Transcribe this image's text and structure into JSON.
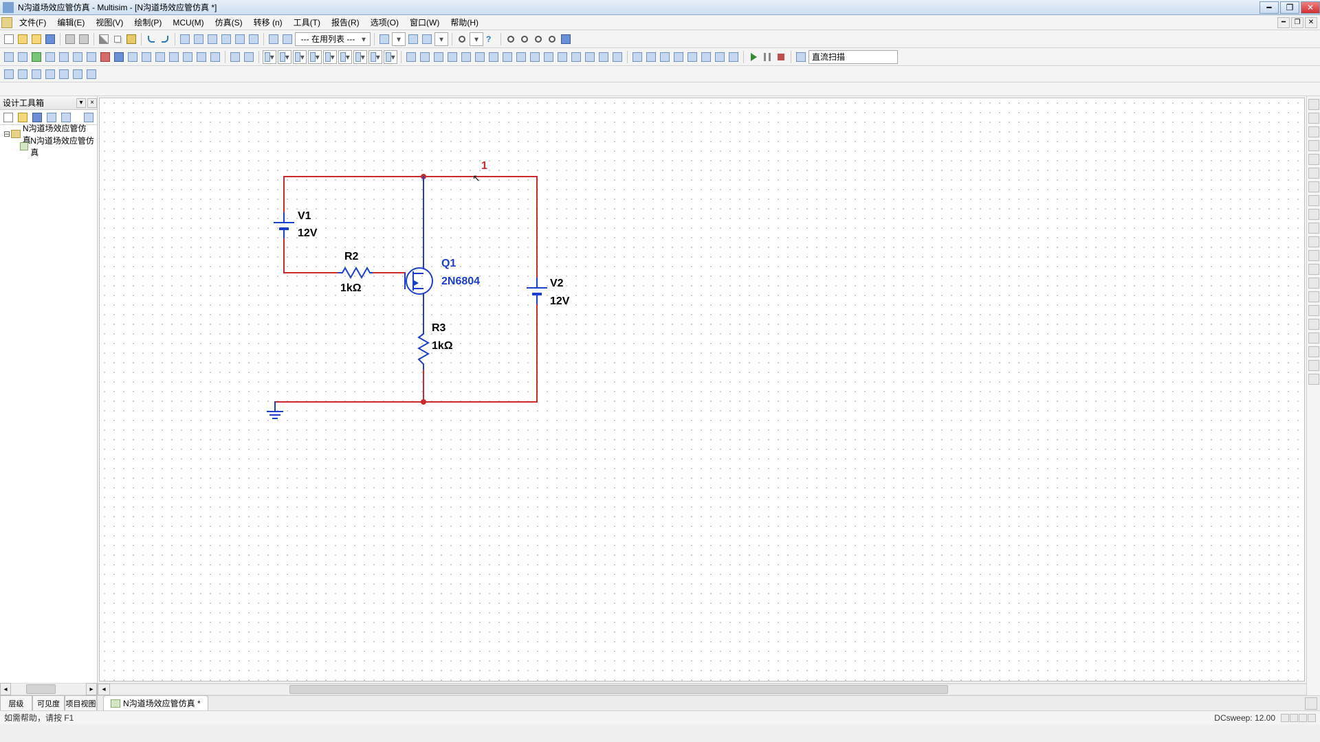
{
  "title": "N沟道场效应管仿真 - Multisim - [N沟道场效应管仿真 *]",
  "menus": [
    "文件(F)",
    "编辑(E)",
    "视图(V)",
    "绘制(P)",
    "MCU(M)",
    "仿真(S)",
    "转移 (n)",
    "工具(T)",
    "报告(R)",
    "选项(O)",
    "窗口(W)",
    "帮助(H)"
  ],
  "combo1": "--- 在用列表 ---",
  "analysis_field": "直流扫描",
  "sidebar": {
    "title": "设计工具箱",
    "root": "N沟道场效应管仿真",
    "child": "N沟道场效应管仿真",
    "tabs": [
      "层级",
      "可见度",
      "项目视图"
    ]
  },
  "doc_tab": "N沟道场效应管仿真 *",
  "schematic": {
    "net1": "1",
    "V1": {
      "ref": "V1",
      "val": "12V"
    },
    "V2": {
      "ref": "V2",
      "val": "12V"
    },
    "R2": {
      "ref": "R2",
      "val": "1kΩ"
    },
    "R3": {
      "ref": "R3",
      "val": "1kΩ"
    },
    "Q1": {
      "ref": "Q1",
      "val": "2N6804"
    }
  },
  "status": {
    "left": "如需帮助，请按 F1",
    "right": "DCsweep: 12.00"
  }
}
